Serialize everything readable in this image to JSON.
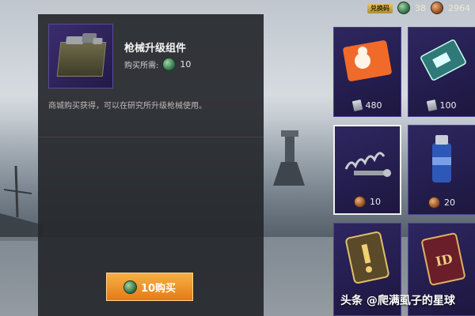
{
  "topbar": {
    "exchange_label": "兑换码",
    "green_balance": "38",
    "bronze_balance": "2964",
    "green_icon": "green-coin-icon",
    "bronze_icon": "bronze-coin-icon"
  },
  "detail": {
    "item_name": "枪械升级组件",
    "price_label": "购买所需:",
    "price_value": "10",
    "description": "商城购买获得，可以在研究所升级枪械使用。",
    "buy_button": "10购买",
    "item_icon": "weapon-parts-crate-icon"
  },
  "grid": {
    "items": [
      {
        "name": "coupon-ticket-icon",
        "price": "480",
        "currency": "voucher"
      },
      {
        "name": "id-card-icon",
        "price": "100",
        "currency": "voucher"
      },
      {
        "name": "weapon-parts-icon",
        "price": "10",
        "currency": "bronze-coin"
      },
      {
        "name": "spray-can-icon",
        "price": "20",
        "currency": "bronze-coin"
      },
      {
        "name": "badge-card-icon",
        "price": "",
        "currency": ""
      },
      {
        "name": "rename-card-icon",
        "price": "",
        "currency": ""
      }
    ]
  },
  "colors": {
    "panel_bg": "#26282c",
    "button_orange": "#e57b16",
    "cell_purple": "#2e2660"
  },
  "watermark": "头条 @爬满虱子的星球"
}
